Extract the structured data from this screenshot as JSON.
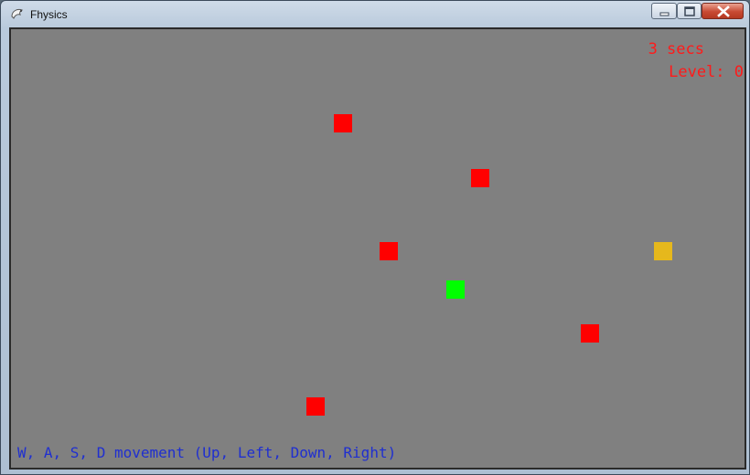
{
  "window": {
    "title": "Fhysics"
  },
  "hud": {
    "timer": "3 secs",
    "level": "Level: 0"
  },
  "help_text": "W, A, S, D movement (Up, Left, Down, Right)",
  "colors": {
    "background": "#808080",
    "enemy": "#ff0000",
    "player": "#00ff00",
    "goal": "#e6b81c",
    "hud_text": "#ff1a1a",
    "help_text": "#1f2fd0"
  },
  "entities": {
    "enemy_count": 5,
    "player_count": 1,
    "goal_count": 1
  }
}
